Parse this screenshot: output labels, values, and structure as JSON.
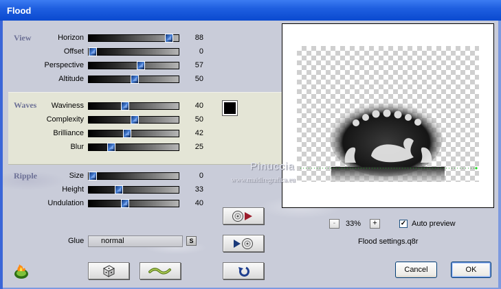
{
  "window": {
    "title": "Flood"
  },
  "groups": {
    "view": "View",
    "waves": "Waves",
    "ripple": "Ripple"
  },
  "sliders": [
    {
      "label": "Horizon",
      "value": "88",
      "fraction": 0.88
    },
    {
      "label": "Offset",
      "value": "0",
      "fraction": 0.0
    },
    {
      "label": "Perspective",
      "value": "57",
      "fraction": 0.57
    },
    {
      "label": "Altitude",
      "value": "50",
      "fraction": 0.5
    },
    {
      "label": "Waviness",
      "value": "40",
      "fraction": 0.4
    },
    {
      "label": "Complexity",
      "value": "50",
      "fraction": 0.5
    },
    {
      "label": "Brilliance",
      "value": "42",
      "fraction": 0.42
    },
    {
      "label": "Blur",
      "value": "25",
      "fraction": 0.25
    },
    {
      "label": "Size",
      "value": "0",
      "fraction": 0.0
    },
    {
      "label": "Height",
      "value": "33",
      "fraction": 0.33
    },
    {
      "label": "Undulation",
      "value": "40",
      "fraction": 0.4
    }
  ],
  "wave_color": "#000000",
  "glue": {
    "label": "Glue",
    "value": "normal",
    "button": "S"
  },
  "preview": {
    "zoom": "33%",
    "zoom_minus": "-",
    "zoom_plus": "+",
    "auto_preview_label": "Auto preview",
    "auto_preview_checked": true,
    "check_mark": "✓",
    "settings_name": "Flood settings.q8r"
  },
  "watermark": {
    "line1": "Pinuccia",
    "line2": "www.maidiregrafica.eu"
  },
  "buttons": {
    "cancel": "Cancel",
    "ok": "OK"
  },
  "icons": {
    "app": "flame-logo-icon",
    "random": "dice-icon",
    "animate": "wave-icon",
    "load": "load-settings-icon",
    "save": "save-settings-icon",
    "reset": "undo-icon"
  },
  "colors": {
    "title_bar": "#0a49cf",
    "client": "#c9ccd9",
    "waves_band": "#e4e5d6",
    "group_label": "#6d7196",
    "slider_thumb": "#2a5db0"
  }
}
